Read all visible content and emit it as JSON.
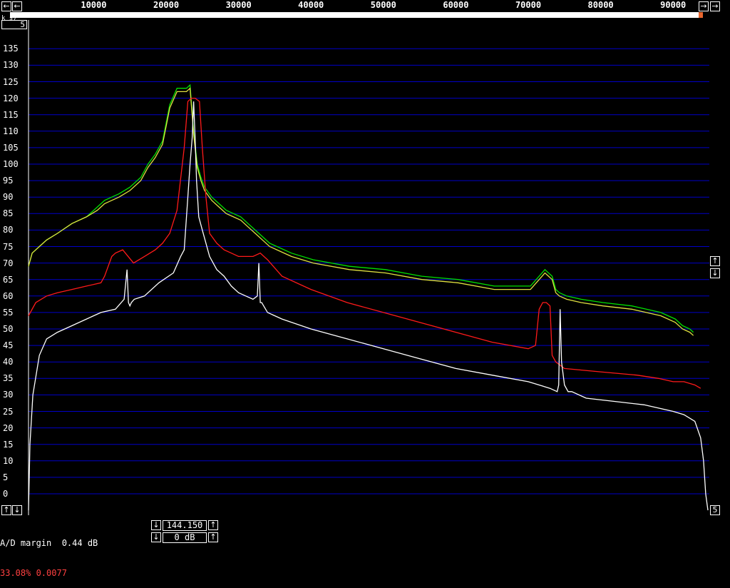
{
  "freq_axis": {
    "ticks": [
      "10000",
      "20000",
      "30000",
      "40000",
      "50000",
      "60000",
      "70000",
      "80000",
      "90000"
    ]
  },
  "controls": {
    "scroll_left_icon": "arrow-left",
    "scroll_right_icon": "arrow-right",
    "top_small_box": "5",
    "corner_marker": "k s7",
    "right_bottom_box": "5",
    "vscroll_up_icon": "arrow-up",
    "vscroll_down_icon": "arrow-down"
  },
  "status": {
    "ad_margin": "A/D margin  0.44 dB",
    "percent_line": "33.08% 0.0077"
  },
  "ref": {
    "top_value": "144.150",
    "bottom_value": "0 dB"
  },
  "colors": {
    "background": "#000000",
    "grid": "#0000c8",
    "white_trace": "#ffffff",
    "red_trace": "#ff1a1a",
    "green_trace": "#00e000",
    "yellow_trace": "#e0e040",
    "scroll_thumb": "#e8662f"
  },
  "chart_data": {
    "type": "line",
    "title": "",
    "xlabel": "",
    "ylabel": "",
    "xlim": [
      1000,
      95000
    ],
    "ylim": [
      -5,
      138
    ],
    "grid": true,
    "y_ticks": [
      0,
      5,
      10,
      15,
      20,
      25,
      30,
      35,
      40,
      45,
      50,
      55,
      60,
      65,
      70,
      75,
      80,
      85,
      90,
      95,
      100,
      105,
      110,
      115,
      120,
      125,
      130,
      135
    ],
    "series": [
      {
        "color": "white",
        "x": [
          1000,
          1200,
          1600,
          2500,
          3500,
          5000,
          7000,
          9000,
          11000,
          13000,
          14200,
          14600,
          14800,
          15000,
          15200,
          15600,
          17000,
          19000,
          21000,
          22000,
          22500,
          23000,
          23300,
          23600,
          23800,
          24000,
          24200,
          24500,
          25000,
          26000,
          27000,
          28000,
          29000,
          30000,
          31000,
          32000,
          32600,
          32800,
          33000,
          33200,
          34000,
          36000,
          40000,
          45000,
          50000,
          55000,
          60000,
          65000,
          70000,
          73000,
          74000,
          74200,
          74400,
          74600,
          75000,
          75500,
          76000,
          78000,
          82000,
          86000,
          88000,
          90000,
          91500,
          93000,
          93800,
          94200,
          94500,
          94800
        ],
        "values": [
          -5,
          15,
          30,
          42,
          47,
          49,
          51,
          53,
          55,
          56,
          59,
          68,
          58,
          57,
          58,
          59,
          60,
          64,
          67,
          72,
          74,
          90,
          100,
          108,
          119,
          108,
          95,
          84,
          80,
          72,
          68,
          66,
          63,
          61,
          60,
          59,
          60,
          70,
          58,
          58,
          55,
          53,
          50,
          47,
          44,
          41,
          38,
          36,
          34,
          32,
          31,
          33,
          56,
          40,
          33,
          31,
          31,
          29,
          28,
          27,
          26,
          25,
          24,
          22,
          17,
          10,
          0,
          -5
        ]
      },
      {
        "color": "red",
        "x": [
          1000,
          2000,
          3500,
          5000,
          7000,
          9000,
          11000,
          11500,
          12500,
          13000,
          14000,
          15500,
          17000,
          18500,
          19500,
          20500,
          21500,
          22500,
          23000,
          23500,
          24000,
          24600,
          25000,
          25500,
          26000,
          27000,
          28000,
          29000,
          30000,
          31000,
          32000,
          33000,
          33500,
          34000,
          36000,
          40000,
          45000,
          50000,
          55000,
          60000,
          65000,
          70000,
          71000,
          71500,
          72000,
          72500,
          73000,
          73300,
          73800,
          75000,
          80000,
          85000,
          88000,
          90000,
          91500,
          93000,
          93800
        ],
        "values": [
          54,
          58,
          60,
          61,
          62,
          63,
          64,
          66,
          72,
          73,
          74,
          70,
          72,
          74,
          76,
          79,
          86,
          105,
          119,
          120,
          120,
          119,
          105,
          90,
          79,
          76,
          74,
          73,
          72,
          72,
          72,
          73,
          72,
          71,
          66,
          62,
          58,
          55,
          52,
          49,
          46,
          44,
          45,
          56,
          58,
          58,
          57,
          42,
          40,
          38,
          37,
          36,
          35,
          34,
          34,
          33,
          32
        ]
      },
      {
        "color": "green",
        "x": [
          1000,
          1500,
          2500,
          3500,
          5000,
          7000,
          9000,
          10500,
          11500,
          12500,
          13500,
          15000,
          16500,
          17500,
          18500,
          19500,
          20500,
          21500,
          22300,
          22800,
          23300,
          23800,
          24300,
          24800,
          25300,
          26300,
          27300,
          28300,
          29300,
          30300,
          31300,
          32300,
          33300,
          34300,
          35300,
          37300,
          40300,
          45300,
          50300,
          55300,
          60300,
          65300,
          70300,
          72300,
          72800,
          73300,
          73800,
          74300,
          75300,
          77300,
          80300,
          84300,
          86300,
          88300,
          89300,
          90300,
          91300,
          92300,
          92800
        ],
        "values": [
          69,
          73,
          75,
          77,
          79,
          82,
          84,
          87,
          89,
          90,
          91,
          93,
          96,
          100,
          103,
          107,
          118,
          123,
          123,
          123,
          124,
          110,
          100,
          96,
          93,
          90,
          88,
          86,
          85,
          84,
          82,
          80,
          78,
          76,
          75,
          73,
          71,
          69,
          68,
          66,
          65,
          63,
          63,
          68,
          67,
          66,
          62,
          61,
          60,
          59,
          58,
          57,
          56,
          55,
          54,
          53,
          51,
          50,
          49
        ]
      },
      {
        "color": "yellow",
        "x": [
          1000,
          1500,
          2500,
          3500,
          5000,
          7000,
          9000,
          10500,
          11500,
          12500,
          13500,
          15000,
          16500,
          17500,
          18500,
          19500,
          20500,
          21500,
          22300,
          22800,
          23300,
          23800,
          24300,
          24800,
          25300,
          26300,
          27300,
          28300,
          29300,
          30300,
          31300,
          32300,
          33300,
          34300,
          35300,
          37300,
          40300,
          45300,
          50300,
          55300,
          60300,
          65300,
          70300,
          72300,
          72800,
          73300,
          73800,
          74300,
          75300,
          77300,
          80300,
          84300,
          86300,
          88300,
          89300,
          90300,
          91300,
          92300,
          92800
        ],
        "values": [
          69,
          73,
          75,
          77,
          79,
          82,
          84,
          86,
          88,
          89,
          90,
          92,
          95,
          99,
          102,
          106,
          117,
          122,
          122,
          122,
          123,
          109,
          99,
          95,
          92,
          89,
          87,
          85,
          84,
          83,
          81,
          79,
          77,
          75,
          74,
          72,
          70,
          68,
          67,
          65,
          64,
          62,
          62,
          67,
          66,
          65,
          61,
          60,
          59,
          58,
          57,
          56,
          55,
          54,
          53,
          52,
          50,
          49,
          48
        ]
      }
    ]
  }
}
